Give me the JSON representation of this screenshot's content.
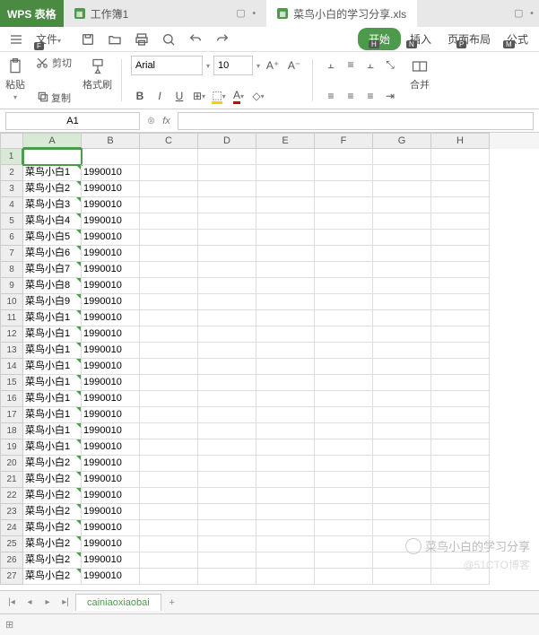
{
  "app_name": "WPS 表格",
  "tabs": [
    {
      "label": "工作簿1",
      "active": false
    },
    {
      "label": "菜鸟小白的学习分享.xls",
      "active": true
    }
  ],
  "menu": {
    "file": "文件"
  },
  "ribbon_tabs": {
    "start": "开始",
    "insert": "插入",
    "page": "页面布局",
    "formula": "公式"
  },
  "key_hints": {
    "file": "F",
    "start": "H",
    "insert": "N",
    "page": "P",
    "formula": "M"
  },
  "toolbar": {
    "paste": "粘贴",
    "cut": "剪切",
    "copy": "复制",
    "fmt_paint": "格式刷",
    "font_name": "Arial",
    "font_size": "10",
    "merge": "合并"
  },
  "namebox": "A1",
  "fx_label": "fx",
  "columns": [
    "A",
    "B",
    "C",
    "D",
    "E",
    "F",
    "G",
    "H"
  ],
  "rows": [
    {
      "n": 1,
      "a": "",
      "b": ""
    },
    {
      "n": 2,
      "a": "菜鸟小白1",
      "b": "1990010"
    },
    {
      "n": 3,
      "a": "菜鸟小白2",
      "b": "1990010"
    },
    {
      "n": 4,
      "a": "菜鸟小白3",
      "b": "1990010"
    },
    {
      "n": 5,
      "a": "菜鸟小白4",
      "b": "1990010"
    },
    {
      "n": 6,
      "a": "菜鸟小白5",
      "b": "1990010"
    },
    {
      "n": 7,
      "a": "菜鸟小白6",
      "b": "1990010"
    },
    {
      "n": 8,
      "a": "菜鸟小白7",
      "b": "1990010"
    },
    {
      "n": 9,
      "a": "菜鸟小白8",
      "b": "1990010"
    },
    {
      "n": 10,
      "a": "菜鸟小白9",
      "b": "1990010"
    },
    {
      "n": 11,
      "a": "菜鸟小白1",
      "b": "1990010"
    },
    {
      "n": 12,
      "a": "菜鸟小白1",
      "b": "1990010"
    },
    {
      "n": 13,
      "a": "菜鸟小白1",
      "b": "1990010"
    },
    {
      "n": 14,
      "a": "菜鸟小白1",
      "b": "1990010"
    },
    {
      "n": 15,
      "a": "菜鸟小白1",
      "b": "1990010"
    },
    {
      "n": 16,
      "a": "菜鸟小白1",
      "b": "1990010"
    },
    {
      "n": 17,
      "a": "菜鸟小白1",
      "b": "1990010"
    },
    {
      "n": 18,
      "a": "菜鸟小白1",
      "b": "1990010"
    },
    {
      "n": 19,
      "a": "菜鸟小白1",
      "b": "1990010"
    },
    {
      "n": 20,
      "a": "菜鸟小白2",
      "b": "1990010"
    },
    {
      "n": 21,
      "a": "菜鸟小白2",
      "b": "1990010"
    },
    {
      "n": 22,
      "a": "菜鸟小白2",
      "b": "1990010"
    },
    {
      "n": 23,
      "a": "菜鸟小白2",
      "b": "1990010"
    },
    {
      "n": 24,
      "a": "菜鸟小白2",
      "b": "1990010"
    },
    {
      "n": 25,
      "a": "菜鸟小白2",
      "b": "1990010"
    },
    {
      "n": 26,
      "a": "菜鸟小白2",
      "b": "1990010"
    },
    {
      "n": 27,
      "a": "菜鸟小白2",
      "b": "1990010"
    }
  ],
  "sheet": {
    "name": "cainiaoxiaobai"
  },
  "watermark": {
    "text": "菜鸟小白的学习分享",
    "sub": "@51CTO博客"
  }
}
